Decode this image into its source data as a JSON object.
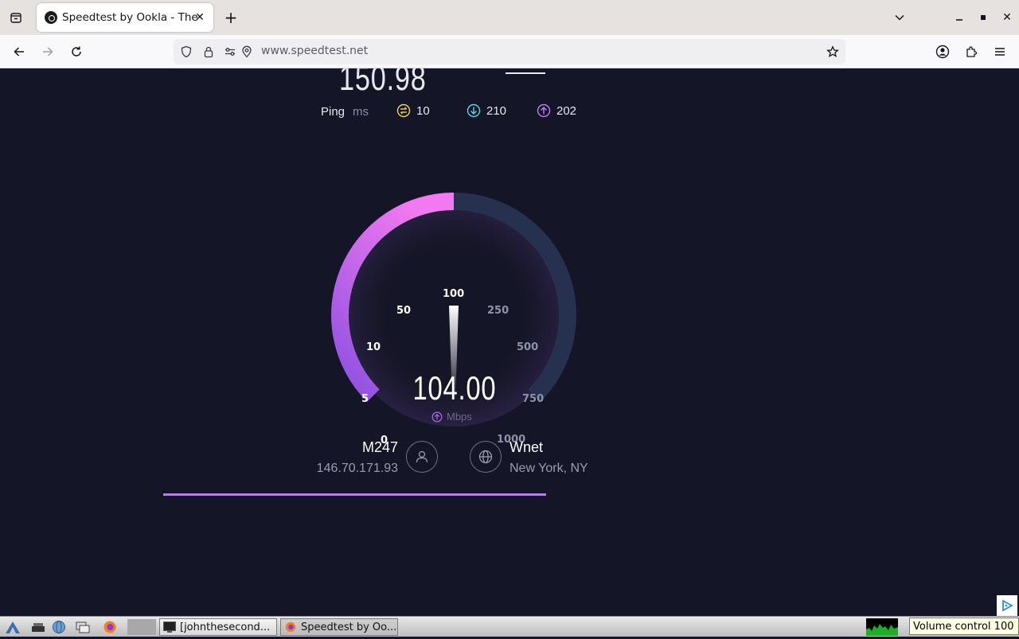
{
  "browser": {
    "tab_title": "Speedtest by Ookla - The Global Broadband Speed Test",
    "url": "www.speedtest.net"
  },
  "result": {
    "previous_value": "150.98",
    "ping_label": "Ping",
    "ping_unit": "ms",
    "ping": "10",
    "download": "210",
    "upload": "202"
  },
  "gauge": {
    "value": "104.00",
    "unit": "Mbps",
    "needle_value": 100,
    "ticks": [
      "0",
      "5",
      "10",
      "50",
      "100",
      "250",
      "500",
      "750",
      "1000"
    ],
    "accent_color": "#c66bf0",
    "track_color": "#26304f"
  },
  "connection": {
    "isp": "M247",
    "ip": "146.70.171.93",
    "server": "Wnet",
    "location": "New York, NY"
  },
  "progress": {
    "percent": 100
  },
  "taskbar": {
    "terminal_label": "[johnthesecond...",
    "firefox_label": "Speedtest by Oo...",
    "volume_tooltip": "Volume control 100"
  }
}
